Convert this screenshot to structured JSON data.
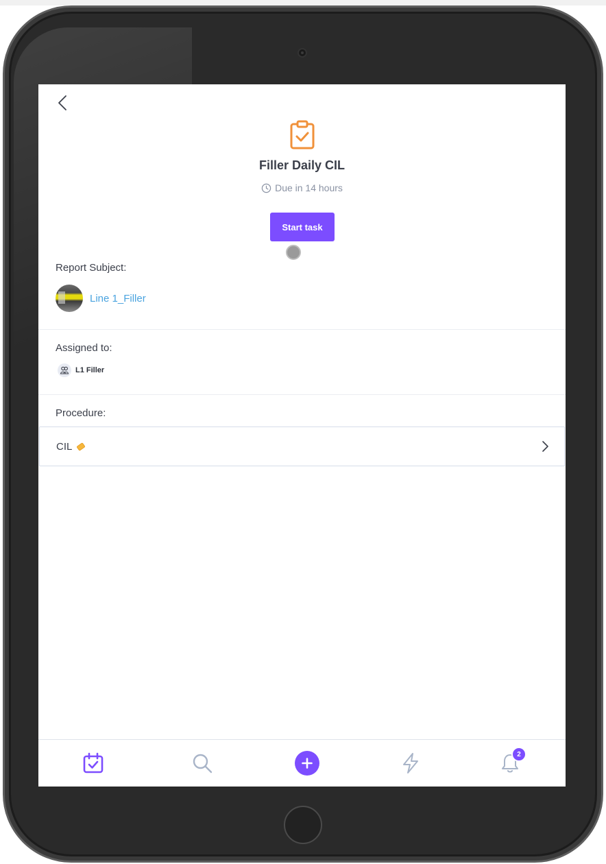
{
  "task": {
    "title": "Filler Daily CIL",
    "due_text": "Due in 14 hours",
    "start_button_label": "Start task"
  },
  "report_subject": {
    "label": "Report Subject:",
    "name": "Line 1_Filler"
  },
  "assigned": {
    "label": "Assigned to:",
    "team_name": "L1 Filler"
  },
  "procedure": {
    "label": "Procedure:",
    "name": "CIL"
  },
  "bottom_nav": {
    "items": [
      {
        "icon": "calendar-check-icon",
        "active": true
      },
      {
        "icon": "search-icon",
        "active": false
      },
      {
        "icon": "add-icon",
        "active": false
      },
      {
        "icon": "lightning-icon",
        "active": false
      },
      {
        "icon": "bell-icon",
        "active": false,
        "badge": "2"
      }
    ]
  },
  "colors": {
    "accent": "#7c4dff",
    "task_icon": "#f0913a",
    "link": "#4aa3df",
    "text": "#3b3f4a",
    "muted": "#8a92a3",
    "nav_inactive": "#a8b4c8"
  }
}
